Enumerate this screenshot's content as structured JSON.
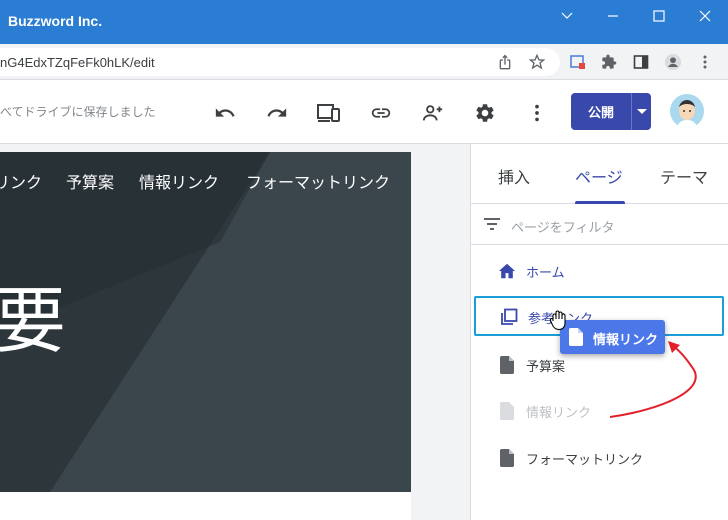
{
  "window": {
    "title": "Buzzword Inc.",
    "controls": [
      "chevron-down-icon",
      "minimize-icon",
      "maximize-icon",
      "close-icon"
    ]
  },
  "address_bar": {
    "url_fragment": "nG4EdxTZqFeFk0hLK/edit",
    "icons": [
      "share-icon",
      "star-icon",
      "extension-alert-icon",
      "puzzle-icon",
      "sidepanel-icon",
      "profile-icon",
      "more-vert-icon"
    ]
  },
  "toolbar": {
    "saved_status": "べてドライブに保存しました",
    "icons": [
      "undo-icon",
      "redo-icon",
      "preview-devices-icon",
      "link-icon",
      "add-person-icon",
      "settings-icon",
      "more-vert-icon"
    ],
    "publish_label": "公開"
  },
  "hero": {
    "nav": [
      "リンク",
      "予算案",
      "情報リンク",
      "フォーマットリンク"
    ],
    "big_text": "要"
  },
  "panel": {
    "tabs": [
      {
        "label": "挿入",
        "active": false
      },
      {
        "label": "ページ",
        "active": true
      },
      {
        "label": "テーマ",
        "active": false
      }
    ],
    "filter_placeholder": "ページをフィルタ",
    "pages": [
      {
        "label": "ホーム",
        "icon": "home-icon",
        "state": "home"
      },
      {
        "label": "参考リンク",
        "icon": "pages-icon",
        "state": "selected"
      },
      {
        "label": "予算案",
        "icon": "page-icon",
        "state": "normal"
      },
      {
        "label": "情報リンク",
        "icon": "page-icon",
        "state": "ghost"
      },
      {
        "label": "フォーマットリンク",
        "icon": "page-icon",
        "state": "normal"
      }
    ],
    "drag_chip_label": "情報リンク"
  },
  "colors": {
    "titlebar": "#2b7cd3",
    "accent": "#3949ab",
    "selection_border": "#1a9fd6",
    "drag_chip": "#4b77e8",
    "annotation_arrow": "#e3202a"
  }
}
